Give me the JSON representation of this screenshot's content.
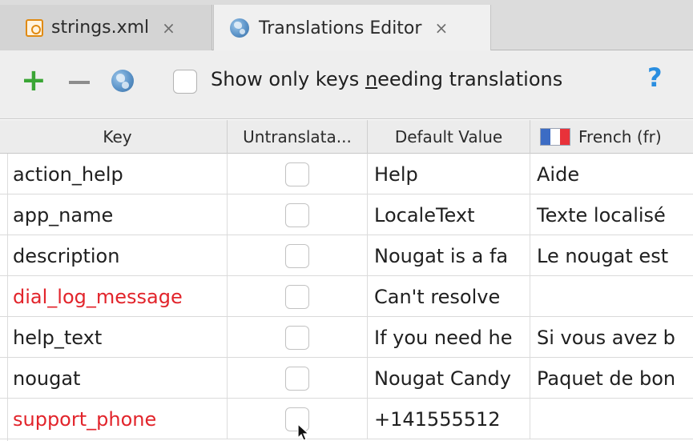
{
  "tabs": [
    {
      "label": "strings.xml",
      "close": "×",
      "icon": "xml-file-icon"
    },
    {
      "label": "Translations Editor",
      "close": "×",
      "icon": "globe-icon"
    }
  ],
  "toolbar": {
    "add": "+",
    "show_only_prefix": "Show only keys ",
    "show_only_underlined": "n",
    "show_only_suffix": "eeding translations",
    "help": "?"
  },
  "table": {
    "headers": {
      "key": "Key",
      "untranslatable": "Untranslata...",
      "default_value": "Default Value",
      "french": "French (fr)"
    },
    "rows": [
      {
        "key": "action_help",
        "default": "Help",
        "fr": "Aide",
        "missing": false
      },
      {
        "key": "app_name",
        "default": "LocaleText",
        "fr": "Texte localisé",
        "missing": false
      },
      {
        "key": "description",
        "default": "Nougat is a fa",
        "fr": "Le nougat est",
        "missing": false
      },
      {
        "key": "dial_log_message",
        "default": "Can't resolve",
        "fr": "",
        "missing": true
      },
      {
        "key": "help_text",
        "default": "If you need he",
        "fr": "Si vous avez b",
        "missing": false
      },
      {
        "key": "nougat",
        "default": "Nougat Candy",
        "fr": "Paquet de bon",
        "missing": false
      },
      {
        "key": "support_phone",
        "default": "+141555512",
        "fr": "",
        "missing": true
      }
    ]
  },
  "colors": {
    "missing_key": "#e2242b",
    "add_icon": "#3aa535",
    "help_icon": "#2a8ee0"
  }
}
